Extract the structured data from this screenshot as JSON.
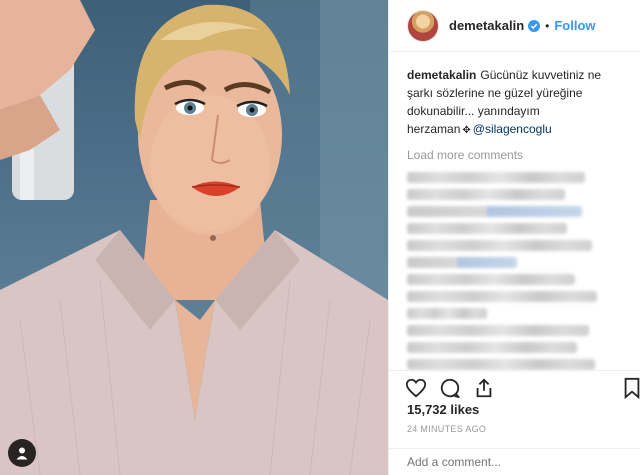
{
  "post": {
    "username": "demetakalin",
    "follow_label": "Follow",
    "separator": "•",
    "caption": {
      "author": "demetakalin",
      "text": "Gücünüz kuvvetiniz ne şarkı sözlerine ne güzel yüreğine dokunabilir... yanındayım herzaman",
      "mention": "@silagencoglu"
    },
    "load_more_label": "Load more comments",
    "likes": "15,732 likes",
    "timestamp": "24 MINUTES AGO",
    "add_comment_placeholder": "Add a comment..."
  },
  "icons": [
    "user-tag-icon",
    "verified-badge-icon",
    "heart-icon",
    "comment-icon",
    "share-icon",
    "bookmark-icon"
  ],
  "colors": {
    "link": "#3897f0",
    "mention": "#003569",
    "muted": "#999999",
    "lipstick": "#d8412a"
  }
}
